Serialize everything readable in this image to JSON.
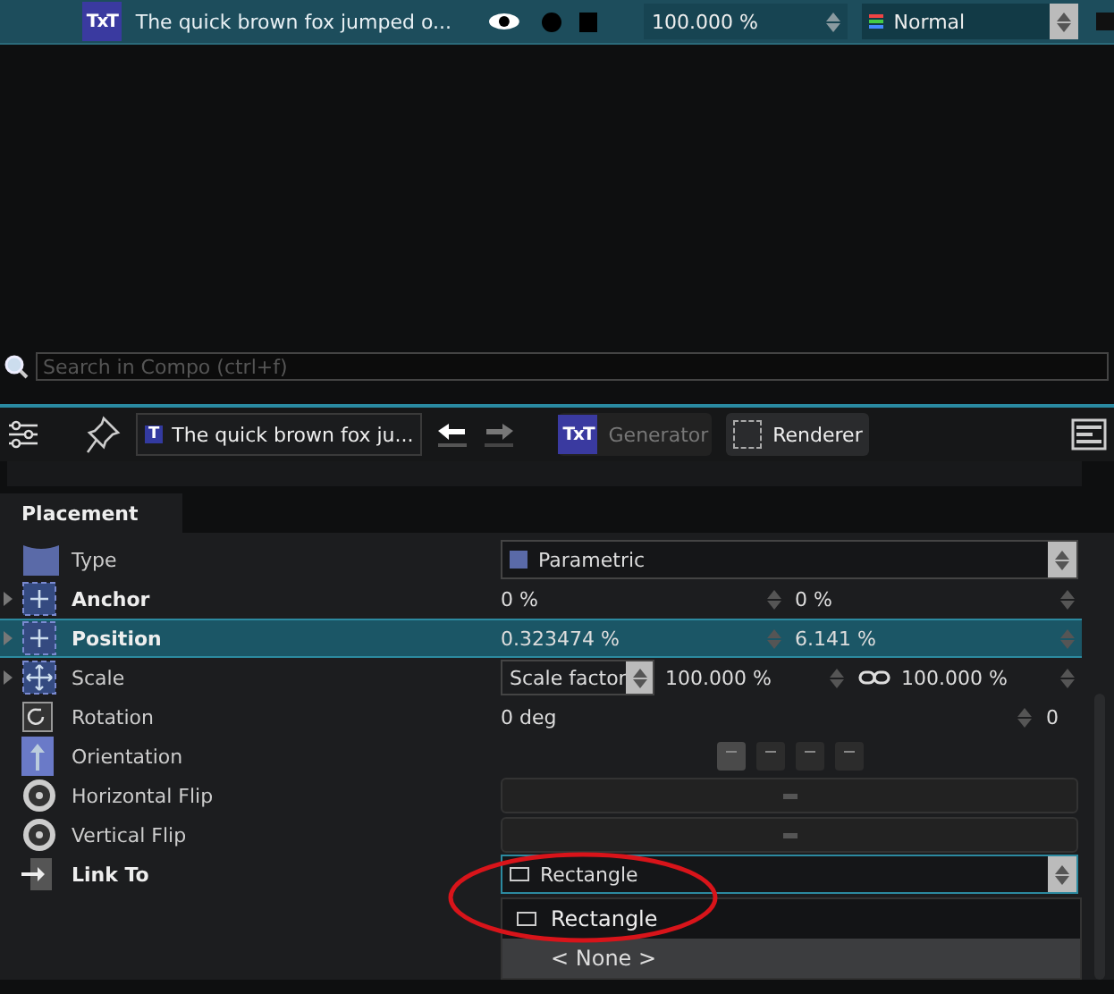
{
  "layer": {
    "badge": "TxT",
    "name": "The quick brown fox jumped o...",
    "visible": true,
    "opacity": "100.000 %",
    "blend": "Normal"
  },
  "search": {
    "placeholder": "Search in Compo (ctrl+f)"
  },
  "toolbar": {
    "layer_badge": "T",
    "generator_badge": "TxT",
    "layer_name": "The quick brown fox ju...",
    "generator": "Generator",
    "renderer": "Renderer"
  },
  "section": {
    "title": "Placement"
  },
  "rows": [
    {
      "label": "Type",
      "bold": false,
      "selected": false,
      "kind": "select",
      "value": "Parametric"
    },
    {
      "label": "Anchor",
      "bold": true,
      "selected": false,
      "kind": "pair",
      "values": [
        "0 %",
        "0 %"
      ]
    },
    {
      "label": "Position",
      "bold": true,
      "selected": true,
      "kind": "pair",
      "values": [
        "0.323474 %",
        "6.141 %"
      ]
    },
    {
      "label": "Scale",
      "bold": false,
      "selected": false,
      "kind": "scale",
      "mode": "Scale factor",
      "values": [
        "100.000 %",
        "100.000 %"
      ]
    },
    {
      "label": "Rotation",
      "bold": false,
      "selected": false,
      "kind": "rotation",
      "values": [
        "0 deg",
        "0"
      ]
    },
    {
      "label": "Orientation",
      "bold": false,
      "selected": false,
      "kind": "align"
    },
    {
      "label": "Horizontal Flip",
      "bold": false,
      "selected": false,
      "kind": "toggle"
    },
    {
      "label": "Vertical Flip",
      "bold": false,
      "selected": false,
      "kind": "toggle"
    },
    {
      "label": "Link To",
      "bold": true,
      "selected": false,
      "kind": "select",
      "value": "Rectangle",
      "open": true
    }
  ],
  "dropdown": [
    {
      "label": "Rectangle",
      "selected": true
    },
    {
      "label": "< None >",
      "selected": false
    }
  ]
}
